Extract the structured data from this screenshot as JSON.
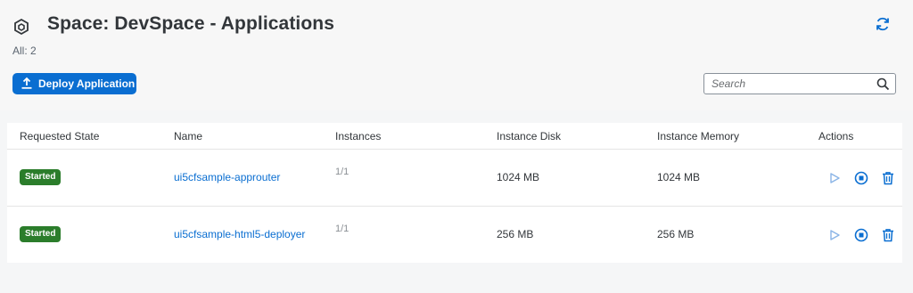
{
  "header": {
    "title": "Space: DevSpace - Applications",
    "count_label": "All: 2"
  },
  "toolbar": {
    "deploy_label": "Deploy Application",
    "search_placeholder": "Search"
  },
  "table": {
    "columns": [
      "Requested State",
      "Name",
      "Instances",
      "Instance Disk",
      "Instance Memory",
      "Actions"
    ],
    "rows": [
      {
        "state": "Started",
        "name": "ui5cfsample-approuter",
        "instances": "1/1",
        "disk": "1024 MB",
        "memory": "1024 MB"
      },
      {
        "state": "Started",
        "name": "ui5cfsample-html5-deployer",
        "instances": "1/1",
        "disk": "256 MB",
        "memory": "256 MB"
      }
    ]
  },
  "icons": {
    "app": "space-cube-icon",
    "refresh": "refresh-icon",
    "deploy": "upload-icon",
    "search": "search-icon",
    "start": "play-icon",
    "stop": "stop-icon",
    "delete": "trash-icon"
  },
  "colors": {
    "accent": "#0a6ed1",
    "started_badge": "#2b7d2b",
    "text": "#32363a",
    "background": "#f5f6f7"
  }
}
